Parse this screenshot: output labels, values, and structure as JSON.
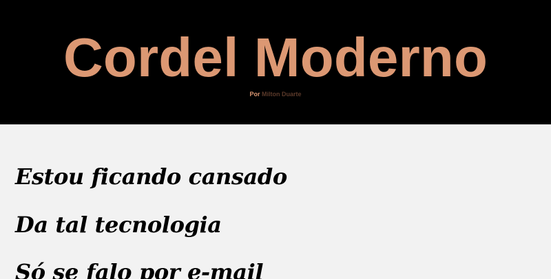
{
  "header": {
    "title": "Cordel Moderno",
    "byline_prefix": "Por",
    "author": "Milton Duarte"
  },
  "poem": {
    "lines": [
      "Estou ficando cansado",
      "Da tal tecnologia",
      "Só se falo por e-mail"
    ]
  },
  "colors": {
    "accent": "#dc9873",
    "header_background": "#000000",
    "page_background": "#f2f2f2",
    "author_text": "#5b3a2a",
    "poem_text": "#000000"
  }
}
